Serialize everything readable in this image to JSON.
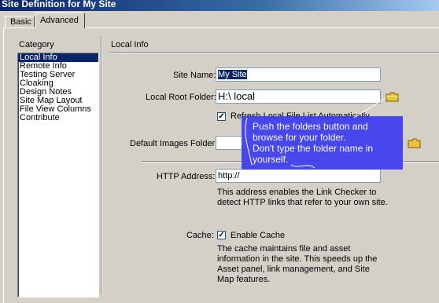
{
  "window": {
    "title": "Site Definition for My Site"
  },
  "tabs": [
    {
      "label": "Basic"
    },
    {
      "label": "Advanced"
    }
  ],
  "category": {
    "heading": "Category",
    "items": [
      {
        "label": "Local Info"
      },
      {
        "label": "Remote Info"
      },
      {
        "label": "Testing Server"
      },
      {
        "label": "Cloaking"
      },
      {
        "label": "Design Notes"
      },
      {
        "label": "Site Map Layout"
      },
      {
        "label": "File View Columns"
      },
      {
        "label": "Contribute"
      }
    ]
  },
  "section": {
    "title": "Local Info"
  },
  "form": {
    "site_name_label": "Site Name:",
    "site_name_value": "My Site",
    "root_folder_label": "Local Root Folder:",
    "root_folder_value": "H:\\ local",
    "refresh_label": "Refresh Local File List Automatically",
    "images_folder_label": "Default Images Folder:",
    "images_folder_value": "",
    "http_label": "HTTP Address:",
    "http_value": "http://",
    "http_note": "This address enables the Link Checker to detect HTTP links that refer to your own site.",
    "cache_label": "Cache:",
    "cache_checkbox_label": "Enable Cache",
    "cache_note": "The cache maintains file and asset information in the site.  This speeds up the Asset panel, link management, and Site Map features."
  },
  "annotation": {
    "text": "Push the folders button and\nbrowse for your folder.\nDon't type the folder name in\nyourself."
  },
  "colors": {
    "callout": "#3c3cf0",
    "selection": "#0a246a",
    "folder": "#e8c23a"
  }
}
